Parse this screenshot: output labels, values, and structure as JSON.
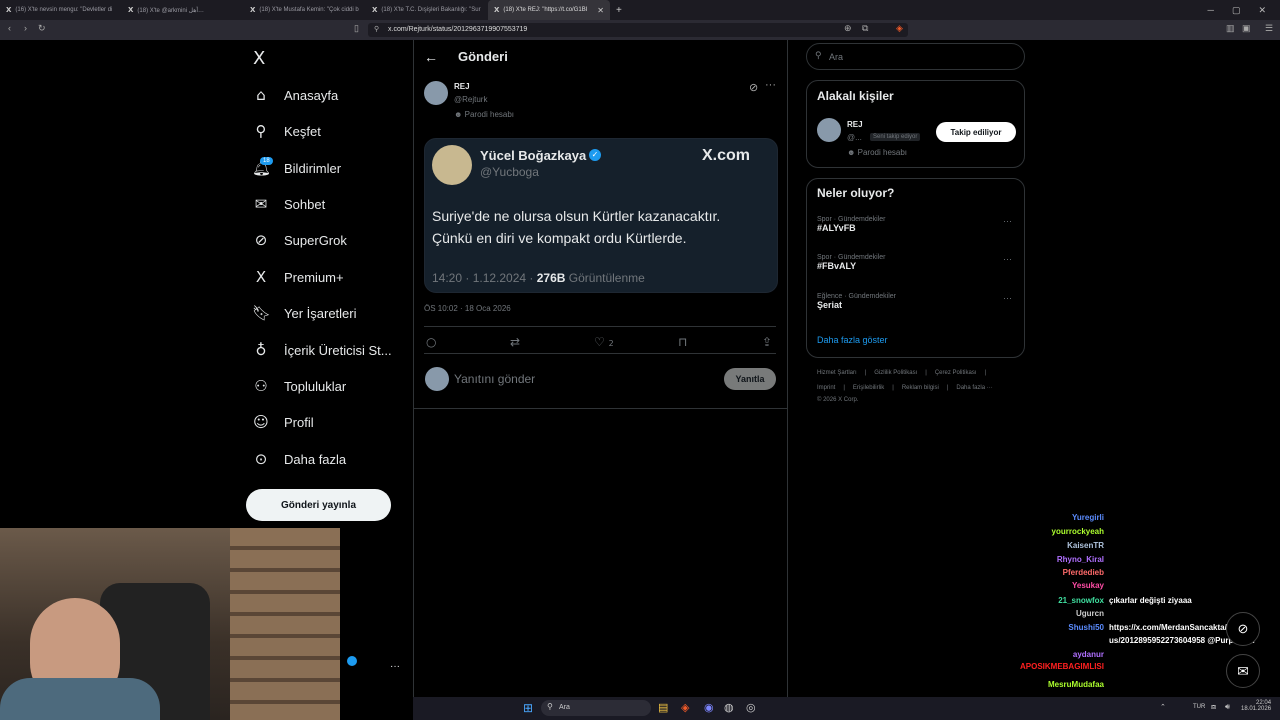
{
  "browser": {
    "tabs": [
      {
        "label": "(16) X'te nevsin mengu: \"Devletler di"
      },
      {
        "label": "(18) X'te ‪@arkmini‬ ‪أهل…‬"
      },
      {
        "label": "(18) X'te Mustafa Kemin: \"Çok ciddi b"
      },
      {
        "label": "(18) X'te T.C. Dışişleri Bakanlığı: \"Sur"
      },
      {
        "label": "(18) X'te REJ: \"https://t.co/G1BI"
      }
    ],
    "url": "x.com/Rejturk/status/2012963719907553719"
  },
  "nav": {
    "logo": "X",
    "items": [
      {
        "label": "Anasayfa",
        "icon": "home-icon"
      },
      {
        "label": "Keşfet",
        "icon": "search-icon"
      },
      {
        "label": "Bildirimler",
        "icon": "bell-icon"
      },
      {
        "label": "Sohbet",
        "icon": "mail-icon"
      },
      {
        "label": "SuperGrok",
        "icon": "grok-icon"
      },
      {
        "label": "Premium+",
        "icon": "x-icon"
      },
      {
        "label": "Yer İşaretleri",
        "icon": "bookmark-icon"
      },
      {
        "label": "İçerik Üreticisi St...",
        "icon": "creator-icon"
      },
      {
        "label": "Topluluklar",
        "icon": "people-icon"
      },
      {
        "label": "Profil",
        "icon": "person-icon"
      },
      {
        "label": "Daha fazla",
        "icon": "more-circle-icon"
      }
    ],
    "notif_badge": "18",
    "post_button": "Gönderi yayınla"
  },
  "post": {
    "header_title": "Gönderi",
    "author_name": "REJ",
    "author_handle": "@Rejturk",
    "parody_label": "Parodi hesabı",
    "quote": {
      "name": "Yücel Boğazkaya",
      "handle": "@Yucboga",
      "brand": "X.com",
      "text_line1": "Suriye'de ne olursa olsun Kürtler kazanacaktır.",
      "text_line2": "Çünkü en diri ve kompakt ordu Kürtlerde.",
      "meta_time": "14:20 · 1.12.2024 · ",
      "meta_views": "276B",
      "meta_views_label": " Görüntülenme"
    },
    "timestamp": "ÖS 10:02 · 18 Oca 2026",
    "likes": "2",
    "reply_placeholder": "Yanıtını gönder",
    "reply_button": "Yanıtla"
  },
  "right": {
    "search_placeholder": "Ara",
    "related_title": "Alakalı kişiler",
    "related_name": "REJ",
    "related_handle": "@...",
    "follows_you": "Seni takip ediyor",
    "related_parody": "Parodi hesabı",
    "following_button": "Takip ediliyor",
    "trends_title": "Neler oluyor?",
    "trends": [
      {
        "category": "Spor · Gündemdekiler",
        "name": "#ALYvFB"
      },
      {
        "category": "Spor · Gündemdekiler",
        "name": "#FBvALY"
      },
      {
        "category": "Eğlence · Gündemdekiler",
        "name": "Şeriat"
      }
    ],
    "show_more": "Daha fazla göster",
    "footer_line1": [
      "Hizmet Şartları",
      "Gizlilik Politikası",
      "Çerez Politikası"
    ],
    "footer_line2": [
      "Imprint",
      "Erişilebilirlik",
      "Reklam bilgisi",
      "Daha fazla ···"
    ],
    "footer_copy": "© 2026 X Corp."
  },
  "chat": [
    {
      "user": "Yuregirli",
      "msg": "",
      "color": "#5b8cff"
    },
    {
      "user": "yourrockyeah",
      "msg": "",
      "color": "#adff2f"
    },
    {
      "user": "KaisenTR",
      "msg": "",
      "color": "#b0c4de"
    },
    {
      "user": "Rhyno_Kiral",
      "msg": "",
      "color": "#b070ff"
    },
    {
      "user": "Pferdedieb",
      "msg": "",
      "color": "#ff6a6a"
    },
    {
      "user": "Yesukay",
      "msg": "",
      "color": "#ff4da6"
    },
    {
      "user": "21_snowfox",
      "msg": "çıkarlar değişti ziyaaa",
      "color": "#40e0a0"
    },
    {
      "user": "Ugurcn",
      "msg": "",
      "color": "#cccccc"
    },
    {
      "user": "Shushi50",
      "msg": "https://x.com/MerdanSancakta/stat",
      "color": "#5b8cff"
    },
    {
      "user": "",
      "msg": "us/2012895952273604958 @PurpleBixi",
      "color": "#ffffff"
    },
    {
      "user": "aydanur",
      "msg": "",
      "color": "#b070ff"
    },
    {
      "user": "APOSIKMEBAGIMLISI",
      "msg": "",
      "color": "#ff2020"
    },
    {
      "user": "MesruMudafaa",
      "msg": "",
      "color": "#adff2f"
    }
  ],
  "taskbar": {
    "search": "Ara",
    "lang": "TUR",
    "time": "22:04",
    "date": "18.01.2026"
  }
}
